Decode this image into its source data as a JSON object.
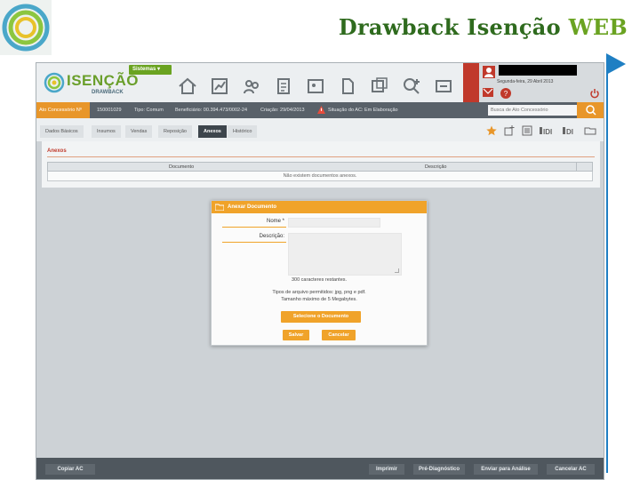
{
  "slide": {
    "title_main": "Drawback Isenção",
    "title_web": "WEB"
  },
  "colors": {
    "accent_orange": "#f0a32a",
    "brand_green": "#6aa321",
    "title_green": "#2f6b1e",
    "deco_blue": "#1f7fc3"
  },
  "app": {
    "logo_text": "ISENÇÃO",
    "logo_sub": "DRAWBACK",
    "menu_button": "Sistemas ▾",
    "toolbar_icons": [
      "home-icon",
      "chart-icon",
      "people-icon",
      "document-icon",
      "photo-icon",
      "file-icon",
      "gallery-icon",
      "search-plus-icon",
      "handshake-icon"
    ],
    "user": {
      "date": "Segunda-feira, 29 Abril 2013"
    },
    "info_bar": {
      "ato_label": "Ato Concessório Nº",
      "ato_number": "150001029",
      "tipo": "Tipo: Comum",
      "beneficiario": "Beneficiário: 00.394.473/0002-24",
      "criacao": "Criação: 29/04/2013",
      "situacao": "Situação do AC: Em Elaboração",
      "search_placeholder": "Busca de Ato Concessório"
    },
    "tabs": [
      {
        "label": "Dados Básicos"
      },
      {
        "label": "Insumos"
      },
      {
        "label": "Vendas"
      },
      {
        "label": "Reposição"
      },
      {
        "label": "Anexos"
      },
      {
        "label": "Histórico"
      }
    ],
    "tab_tools": [
      "star-icon",
      "add-item-icon",
      "list-icon",
      "IDI",
      "DI",
      "CO"
    ],
    "anexos": {
      "section_title": "Anexos",
      "columns": [
        "Documento",
        "Descrição"
      ],
      "empty_message": "Não existem documentos anexos."
    },
    "modal": {
      "title": "Anexar Documento",
      "nome_label": "Nome *",
      "descricao_label": "Descrição:",
      "chars_remaining": "300 caracteres restantes.",
      "allowed_types": "Tipos de arquivo permitidos: jpg, png e pdf.",
      "max_size": "Tamanho máximo de 5 Megabytes.",
      "select_button": "Selecione o Documento",
      "save_button": "Salvar",
      "cancel_button": "Cancelar"
    },
    "footer": {
      "copy": "Copiar AC",
      "print": "Imprimir",
      "pre_diag": "Pré-Diagnóstico",
      "send": "Enviar para Análise",
      "cancel_ac": "Cancelar AC"
    }
  }
}
